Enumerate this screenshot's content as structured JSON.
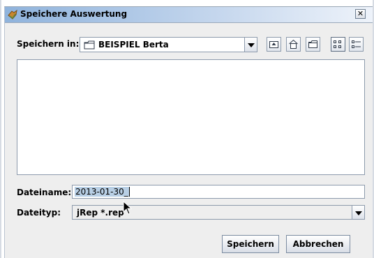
{
  "dialog": {
    "title": "Speichere Auswertung",
    "close_symbol": "✕"
  },
  "save_in": {
    "label": "Speichern in:",
    "value": "BEISPIEL Berta",
    "folder_icon": "folder-icon"
  },
  "toolbar": {
    "buttons": [
      {
        "name": "up-one-level-icon"
      },
      {
        "name": "home-icon"
      },
      {
        "name": "new-folder-icon"
      },
      {
        "name": "list-view-icon"
      },
      {
        "name": "details-view-icon"
      }
    ]
  },
  "file_list": {
    "items": []
  },
  "file_name": {
    "label": "Dateiname:",
    "value": "2013-01-30_"
  },
  "file_type": {
    "label": "Dateityp:",
    "value": "jRep   *.rep"
  },
  "buttons": {
    "save": "Speichern",
    "cancel": "Abbrechen"
  }
}
